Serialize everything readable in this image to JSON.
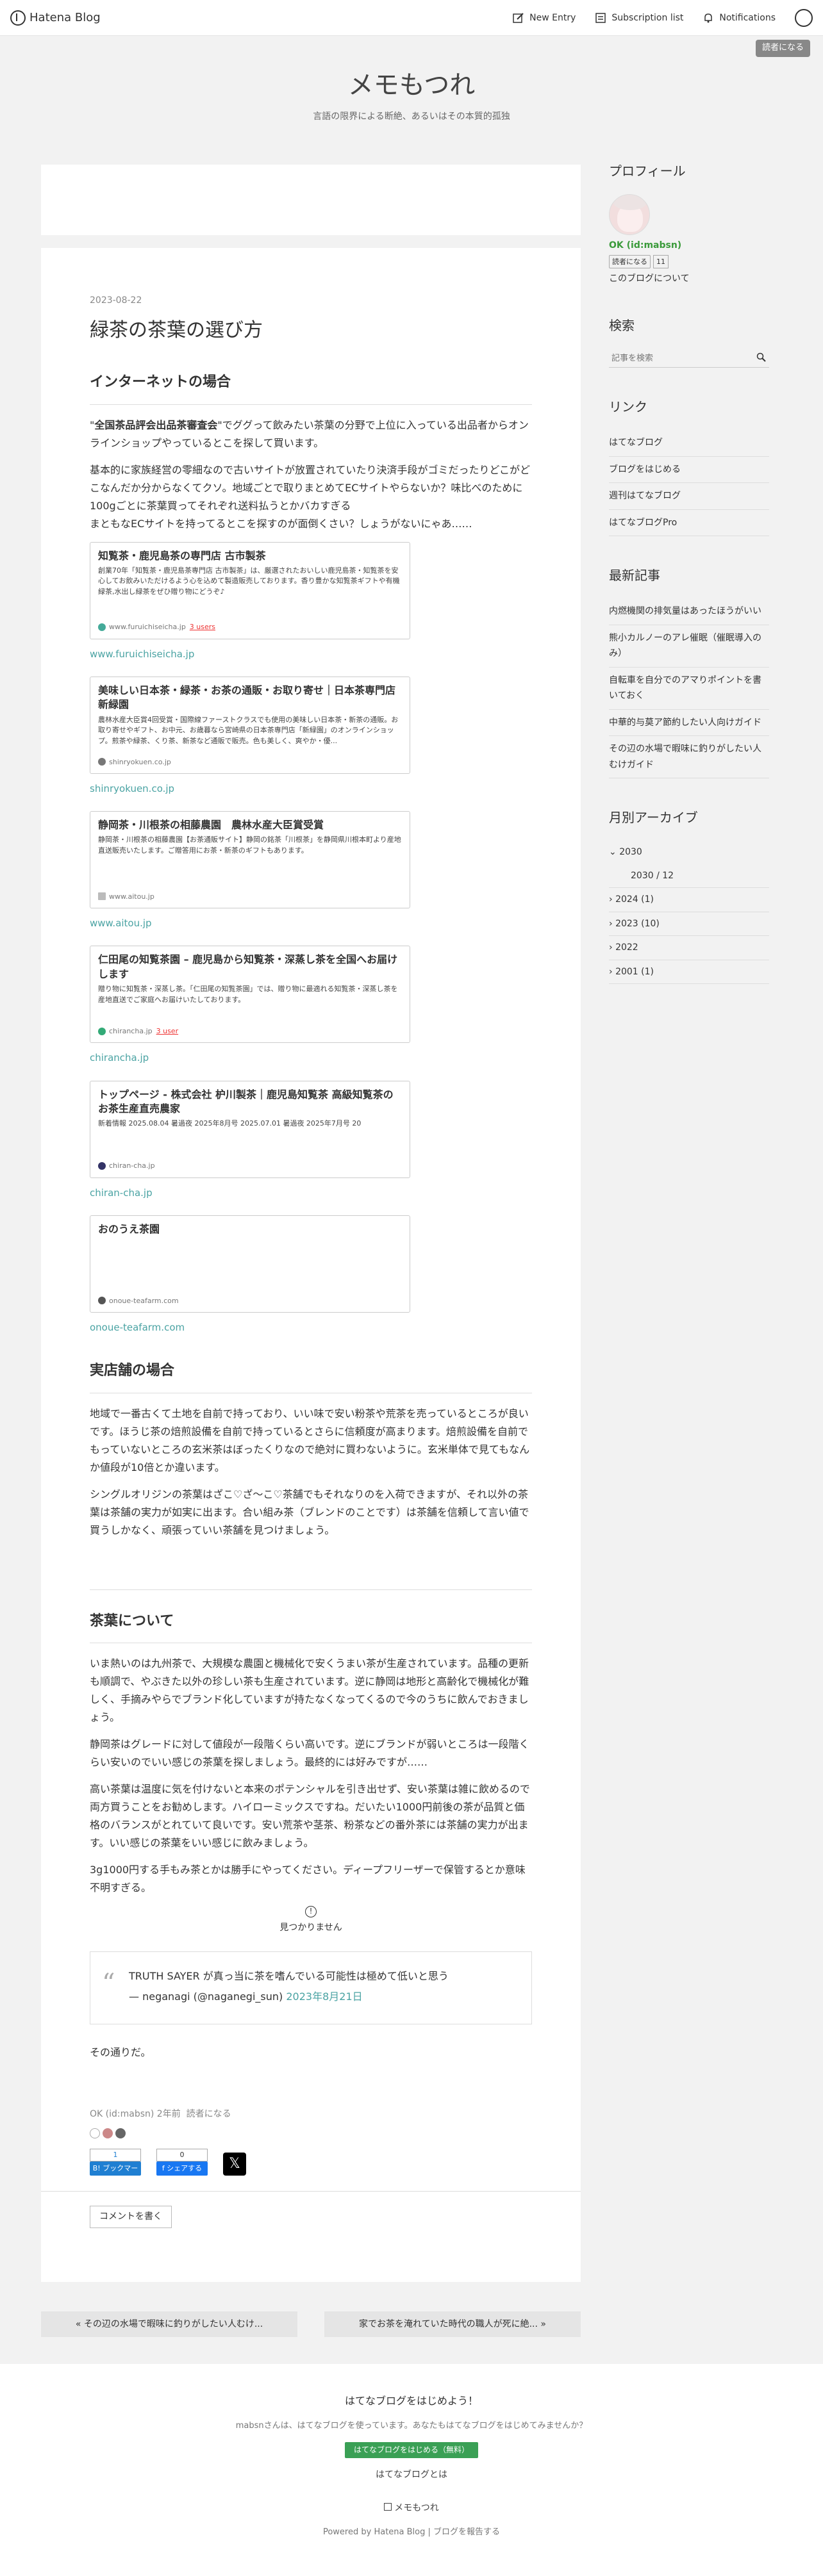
{
  "header": {
    "logo": "Hatena Blog",
    "new_entry": "New Entry",
    "subscription": "Subscription list",
    "notifications": "Notifications",
    "reader": "読者になる"
  },
  "blog": {
    "title": "メモもつれ",
    "description": "言語の限界による断絶、あるいはその本質的孤独"
  },
  "article": {
    "date": "2023-08-22",
    "title": "緑茶の茶葉の選び方",
    "h_internet": "インターネットの場合",
    "p1_bold": "全国茶品評会出品茶審査会",
    "p1_pre": "\"",
    "p1_post": "\"でググって飲みたい茶葉の分野で上位に入っている出品者からオンラインショップやっているとこを探して買います。",
    "p2": "基本的に家族経営の零細なので古いサイトが放置されていたり決済手段がゴミだったりどこがどこなんだか分からなくてクソ。地域ごとで取りまとめてECサイトやらないか？味比べのために100gごとに茶葉買ってそれぞれ送料払うとかバカすぎる\nまともなECサイトを持ってるとこを探すのが面倒くさい？しょうがないにゃあ……",
    "cards": [
      {
        "title": "知覧茶・鹿児島茶の専門店 古市製茶",
        "desc": "創業70年「知覧茶・鹿児島茶専門店 古市製茶」は、厳選されたおいしい鹿児島茶・知覧茶を安心してお飲みいただけるよう心を込めて製造販売しております。香り豊かな知覧茶ギフトや有機緑茶,水出し緑茶をぜひ贈り物にどうぞ♪",
        "site": "www.furuichiseicha.jp",
        "users": "3 users",
        "link": "www.furuichiseicha.jp"
      },
      {
        "title": "美味しい日本茶・緑茶・お茶の通販・お取り寄せ｜日本茶専門店 新緑園",
        "desc": "農林水産大臣賞4回受賞・国際線ファーストクラスでも使用の美味しい日本茶・新茶の通販。お取り寄せやギフト、お中元、お歳暮なら宮崎県の日本茶専門店「新緑園」のオンラインショップ。煎茶や緑茶、くり茶、新茶など通販で販売。色も美しく、爽やか・優...",
        "site": "shinryokuen.co.jp",
        "users": "",
        "link": "shinryokuen.co.jp"
      },
      {
        "title": "静岡茶・川根茶の相藤農園　農林水産大臣賞受賞",
        "desc": "静岡茶・川根茶の相藤農園【お茶通販サイト】静岡の銘茶「川根茶」を静岡県川根本町より産地直送販売いたします。ご贈答用にお茶・新茶のギフトもあります。",
        "site": "www.aitou.jp",
        "users": "",
        "link": "www.aitou.jp"
      },
      {
        "title": "仁田尾の知覧茶園 – 鹿児島から知覧茶・深蒸し茶を全国へお届けします",
        "desc": "贈り物に知覧茶・深蒸し茶。「仁田尾の知覧茶園」では、贈り物に最適れる知覧茶・深蒸し茶を産地直送でご家庭へお届けいたしております。",
        "site": "chirancha.jp",
        "users": "3 user",
        "link": "chirancha.jp"
      },
      {
        "title": "トップページ - 株式会社 枦川製茶｜鹿児島知覧茶 高級知覧茶のお茶生産直売農家",
        "desc": "新着情報 2025.08.04 暑過夜 2025年8月号 2025.07.01 暑過夜 2025年7月号 20",
        "site": "chiran-cha.jp",
        "users": "",
        "link": "chiran-cha.jp"
      },
      {
        "title": "おのうえ茶園",
        "desc": "",
        "site": "onoue-teafarm.com",
        "users": "",
        "link": "onoue-teafarm.com"
      }
    ],
    "h_store": "実店舗の場合",
    "p3": "地域で一番古くて土地を自前で持っており、いい味で安い粉茶や荒茶を売っているところが良いです。ほうじ茶の焙煎設備を自前で持っているとさらに信頼度が高まります。焙煎設備を自前でもっていないところの玄米茶はぼったくりなので絶対に買わないように。玄米単体で見てもなんか値段が10倍とか違います。",
    "p4": "シングルオリジンの茶葉はざこ♡ざ〜こ♡茶舗でもそれなりのを入荷できますが、それ以外の茶葉は茶舗の実力が如実に出ます。合い組み茶（ブレンドのことです）は茶舗を信頼して言い値で買うしかなく、頑張っていい茶舗を見つけましょう。",
    "h_about": "茶葉について",
    "p5": "いま熱いのは九州茶で、大規模な農園と機械化で安くうまい茶が生産されています。品種の更新も順調で、やぶきた以外の珍しい茶も生産されています。逆に静岡は地形と高齢化で機械化が難しく、手摘みやらでブランド化していますが持たなくなってくるので今のうちに飲んでおきましょう。",
    "p6": "静岡茶はグレードに対して値段が一段階くらい高いです。逆にブランドが弱いところは一段階くらい安いのでいい感じの茶葉を探しましょう。最終的には好みですが……",
    "p7": "高い茶葉は温度に気を付けないと本来のポテンシャルを引き出せず、安い茶葉は雑に飲めるので両方買うことをお勧めします。ハイローミックスですね。だいたい1000円前後の茶が品質と価格のバランスがとれていて良いです。安い荒茶や茎茶、粉茶などの番外茶には茶舗の実力が出ます。いい感じの茶葉をいい感じに飲みましょう。",
    "p8": "3g1000円する手もみ茶とかは勝手にやってください。ディープフリーザーで保管するとか意味不明すぎる。",
    "not_found": "見つかりません",
    "quote_text": "TRUTH SAYER が真っ当に茶を嗜んでいる可能性は極めて低いと思う",
    "quote_author": "— neganagi (@naganegi_sun)",
    "quote_date": "2023年8月21日",
    "p9": "その通りだ。",
    "meta_author": "OK (id:mabsn)",
    "meta_time": "2年前",
    "meta_reader": "読者になる",
    "bookmark_count": "1",
    "bookmark_label": "B! ブックマーク",
    "share_count": "0",
    "share_label": "f シェアする",
    "comment": "コメントを書く"
  },
  "sidebar": {
    "profile_title": "プロフィール",
    "profile_name": "OK (id:mabsn)",
    "reader_btn": "読者になる",
    "reader_count": "11",
    "about": "このブログについて",
    "search_title": "検索",
    "search_placeholder": "記事を検索",
    "links_title": "リンク",
    "links": [
      "はてなブログ",
      "ブログをはじめる",
      "週刊はてなブログ",
      "はてなブログPro"
    ],
    "recent_title": "最新記事",
    "recent": [
      "内燃機関の排気量はあったほうがいい",
      "熊小カルノーのアレ催眠（催眠導入のみ）",
      "自転車を自分でのアマりポイントを書いておく",
      "中華的与莫ア節約したい人向けガイド",
      "その辺の水場で暇味に釣りがしたい人むけガイド"
    ],
    "archive_title": "月別アーカイブ",
    "archive": [
      "2030",
      "2030 / 12",
      "2024 (1)",
      "2023 (10)",
      "2022",
      "2001 (1)"
    ]
  },
  "pager": {
    "prev": "« その辺の水場で暇味に釣りがしたい人むけ...",
    "next": "家でお茶を淹れていた時代の職人が死に絶... »"
  },
  "footer": {
    "headline": "はてなブログをはじめよう！",
    "text": "mabsnさんは、はてなブログを使っています。あなたもはてなブログをはじめてみませんか？",
    "cta": "はてなブログをはじめる（無料）",
    "what": "はてなブログとは",
    "blogname": "メモもつれ",
    "powered": "Powered by Hatena Blog | ブログを報告する"
  }
}
